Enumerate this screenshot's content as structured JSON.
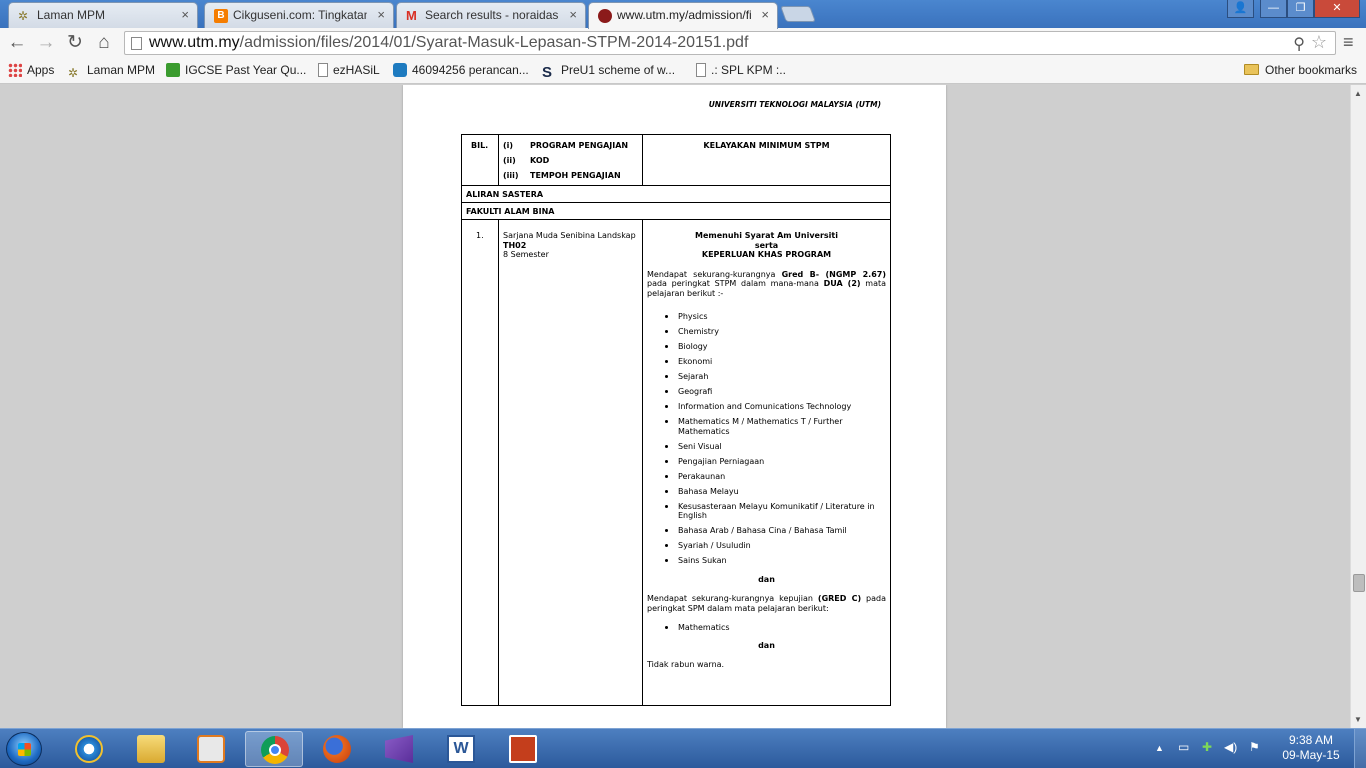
{
  "browser": {
    "tabs": [
      {
        "title": "Laman MPM",
        "icon": "star-icon",
        "active": false
      },
      {
        "title": "Cikguseni.com: Tingkatan",
        "icon": "blogger-icon",
        "active": false
      },
      {
        "title": "Search results - noraidasm",
        "icon": "gmail-icon",
        "active": false
      },
      {
        "title": "www.utm.my/admission/fi",
        "icon": "utm-icon",
        "active": true
      }
    ],
    "close_glyph": "×",
    "window_controls": {
      "user": "👤",
      "minimize": "—",
      "maximize": "❐",
      "close": "✕"
    },
    "nav": {
      "back": "←",
      "forward": "→",
      "reload": "↻",
      "home": "⌂"
    },
    "url": {
      "host": "www.utm.my",
      "path": "/admission/files/2014/01/Syarat-Masuk-Lepasan-STPM-2014-20151.pdf"
    },
    "zoom_glyph": "⚲",
    "star_glyph": "☆",
    "menu_glyph": "≡",
    "bookmarks": [
      {
        "label": "Apps",
        "icon": "apps-grid-icon"
      },
      {
        "label": "Laman MPM",
        "icon": "star-icon"
      },
      {
        "label": "IGCSE Past Year Qu...",
        "icon": "green-cube-icon"
      },
      {
        "label": "ezHASiL",
        "icon": "page-icon"
      },
      {
        "label": "46094256 perancan...",
        "icon": "scribd-icon"
      },
      {
        "label": "PreU1 scheme of w...",
        "icon": "s-logo-icon"
      },
      {
        "label": ".: SPL KPM :..",
        "icon": "page-icon"
      }
    ],
    "other_bookmarks": "Other bookmarks"
  },
  "document": {
    "university": "UNIVERSITI TEKNOLOGI MALAYSIA (UTM)",
    "header": {
      "bil": "BIL.",
      "items": [
        {
          "num": "(i)",
          "label": "PROGRAM PENGAJIAN"
        },
        {
          "num": "(ii)",
          "label": "KOD"
        },
        {
          "num": "(iii)",
          "label": "TEMPOH PENGAJIAN"
        }
      ],
      "kelayakan": "KELAYAKAN MINIMUM STPM"
    },
    "stream": "ALIRAN SASTERA",
    "faculty": "FAKULTI ALAM BINA",
    "entry": {
      "bil": "1.",
      "program": "Sarjana Muda Senibina Landskap",
      "code": "TH02",
      "duration": "8 Semester",
      "req_title_1": "Memenuhi Syarat Am Universiti",
      "req_title_2": "serta",
      "req_title_3": "KEPERLUAN KHAS PROGRAM",
      "para1_a": "Mendapat sekurang-kurangnya ",
      "para1_b": "Gred B- (NGMP 2.67)",
      "para1_c": " pada peringkat STPM dalam mana-mana ",
      "para1_d": "DUA (2)",
      "para1_e": " mata pelajaran berikut :-",
      "subjects": [
        "Physics",
        "Chemistry",
        "Biology",
        "Ekonomi",
        "Sejarah",
        "Geografi",
        "Information and Comunications Technology",
        "Mathematics M / Mathematics T / Further Mathematics",
        "Seni Visual",
        "Pengajian Perniagaan",
        "Perakaunan",
        "Bahasa Melayu",
        "Kesusasteraan Melayu Komunikatif / Literature in English",
        "Bahasa Arab / Bahasa Cina / Bahasa Tamil",
        "Syariah / Usuludin",
        "Sains Sukan"
      ],
      "dan_1": "dan",
      "para2_a": "Mendapat sekurang-kurangnya kepujian ",
      "para2_b": "(GRED C)",
      "para2_c": " pada peringkat SPM dalam mata pelajaran berikut:",
      "spm_subjects": [
        "Mathematics"
      ],
      "dan_2": "dan",
      "para3": "Tidak rabun warna."
    }
  },
  "taskbar": {
    "items": [
      {
        "name": "internet-explorer-icon"
      },
      {
        "name": "file-explorer-icon"
      },
      {
        "name": "media-player-icon"
      },
      {
        "name": "chrome-icon",
        "pressed": true
      },
      {
        "name": "firefox-icon"
      },
      {
        "name": "visual-studio-icon"
      },
      {
        "name": "word-icon"
      },
      {
        "name": "powerpoint-icon"
      }
    ],
    "tray_icons": {
      "show_hidden": "▲",
      "flag": "⚑"
    },
    "time": "9:38 AM",
    "date": "09-May-15"
  },
  "colors": {
    "titlebar": "#3a72bd",
    "taskbar": "#2c5a9c",
    "viewer_bg": "#cfcfcf"
  }
}
